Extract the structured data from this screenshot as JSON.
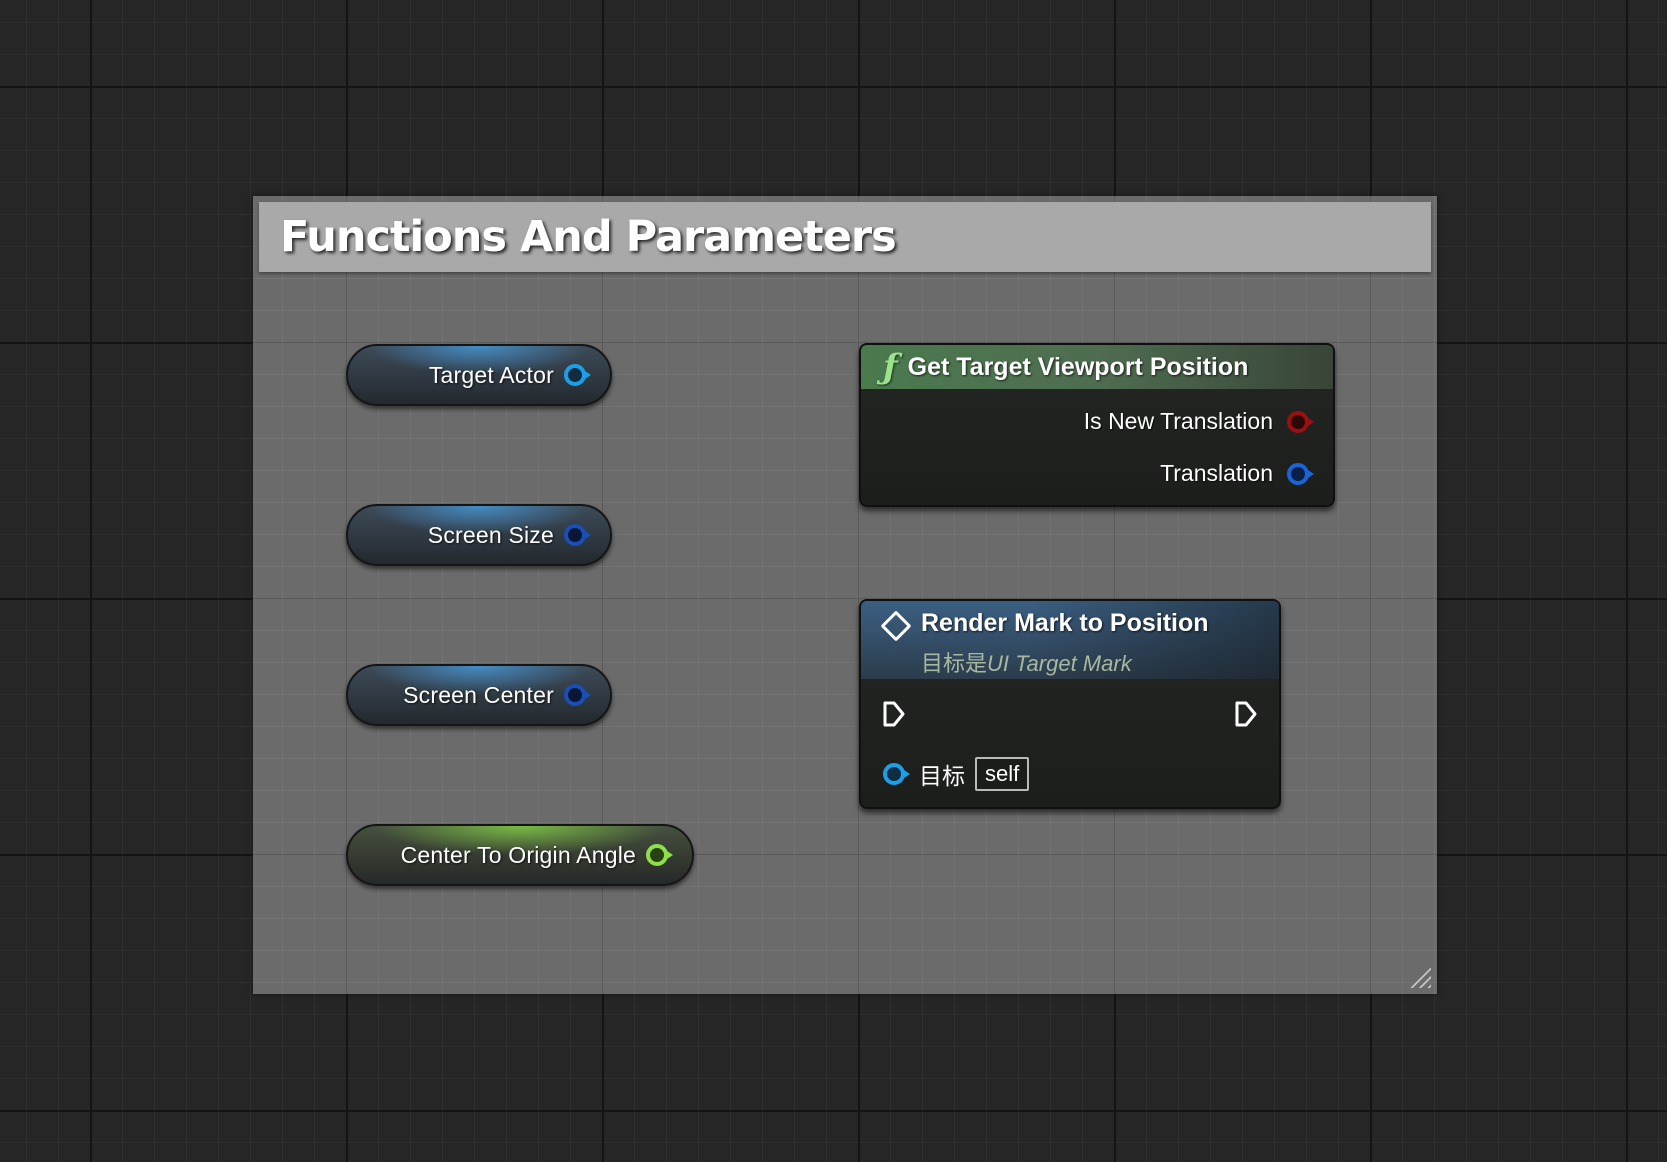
{
  "comment": {
    "title": "Functions And Parameters"
  },
  "variables": [
    {
      "label": "Target Actor",
      "pin": "object"
    },
    {
      "label": "Screen Size",
      "pin": "vector"
    },
    {
      "label": "Screen Center",
      "pin": "vector"
    },
    {
      "label": "Center To Origin Angle",
      "pin": "float"
    }
  ],
  "get_viewport_node": {
    "icon": "function-f-icon",
    "title": "Get Target Viewport Position",
    "outputs": [
      {
        "label": "Is New Translation",
        "pin": "bool"
      },
      {
        "label": "Translation",
        "pin": "vector"
      }
    ]
  },
  "render_node": {
    "icon": "event-diamond-icon",
    "title": "Render Mark to Position",
    "subtitle_prefix": "目标是",
    "subtitle_class": "UI Target Mark",
    "target_label": "目标",
    "target_value": "self"
  },
  "colors": {
    "background": "#262626",
    "comment_body": "#6b6b6b",
    "comment_header": "#a9a9a9",
    "object_pin": "#1aa0e8",
    "vector_pin": "#1b64d8",
    "float_pin": "#8ee04a",
    "bool_pin": "#9a1010",
    "function_header": "#4a7a4e",
    "event_header": "#35506b"
  }
}
